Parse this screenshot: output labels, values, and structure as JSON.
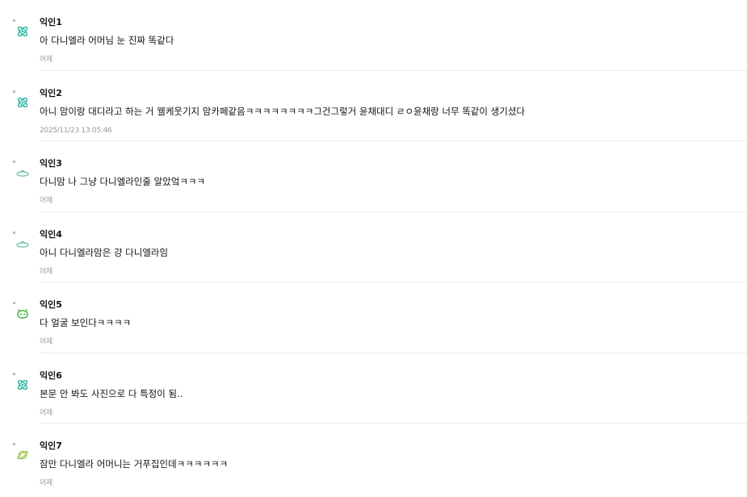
{
  "comments": [
    {
      "nick": "익인1",
      "text": "아 다니엘라 어머님 눈 진짜 똑같다",
      "time": "어제",
      "avatar_icon": "atom-icon",
      "avatar_color": "#3cb8a4"
    },
    {
      "nick": "익인2",
      "text": "아니 맘이랑 대디라고 하는 거 웰케웃기지 맘카페같음ㅋㅋㅋㅋㅋㅋㅋㅋ그건그렇거 윤채대디 ㄹㅇ윤채랑 너무 똑같이 생기셨다",
      "time": "2025/11/23 13:05:46",
      "avatar_icon": "atom-icon",
      "avatar_color": "#3cb8a4"
    },
    {
      "nick": "익인3",
      "text": "다니맘 나 그냥 다니엘라인줄 알았엌ㅋㅋㅋ",
      "time": "어제",
      "avatar_icon": "ufo-icon",
      "avatar_color": "#6fc3a3"
    },
    {
      "nick": "익인4",
      "text": "아니 다니엘라맘은 걍 다니엘라임",
      "time": "어제",
      "avatar_icon": "ufo-icon",
      "avatar_color": "#6fc3a3"
    },
    {
      "nick": "익인5",
      "text": "다 얼굴 보인다ㅋㅋㅋㅋ",
      "time": "어제",
      "avatar_icon": "alien-icon",
      "avatar_color": "#4caf50"
    },
    {
      "nick": "익인6",
      "text": "본문 안 봐도 사진으로 다 특정이 됨..",
      "time": "어제",
      "avatar_icon": "atom-icon",
      "avatar_color": "#3cb8a4"
    },
    {
      "nick": "익인7",
      "text": "잠만 다니엘라 어머니는 거푸집인데ㅋㅋㅋㅋㅋㅋ",
      "time": "어제",
      "avatar_icon": "planet-icon",
      "avatar_color": "#9cc53a"
    }
  ]
}
